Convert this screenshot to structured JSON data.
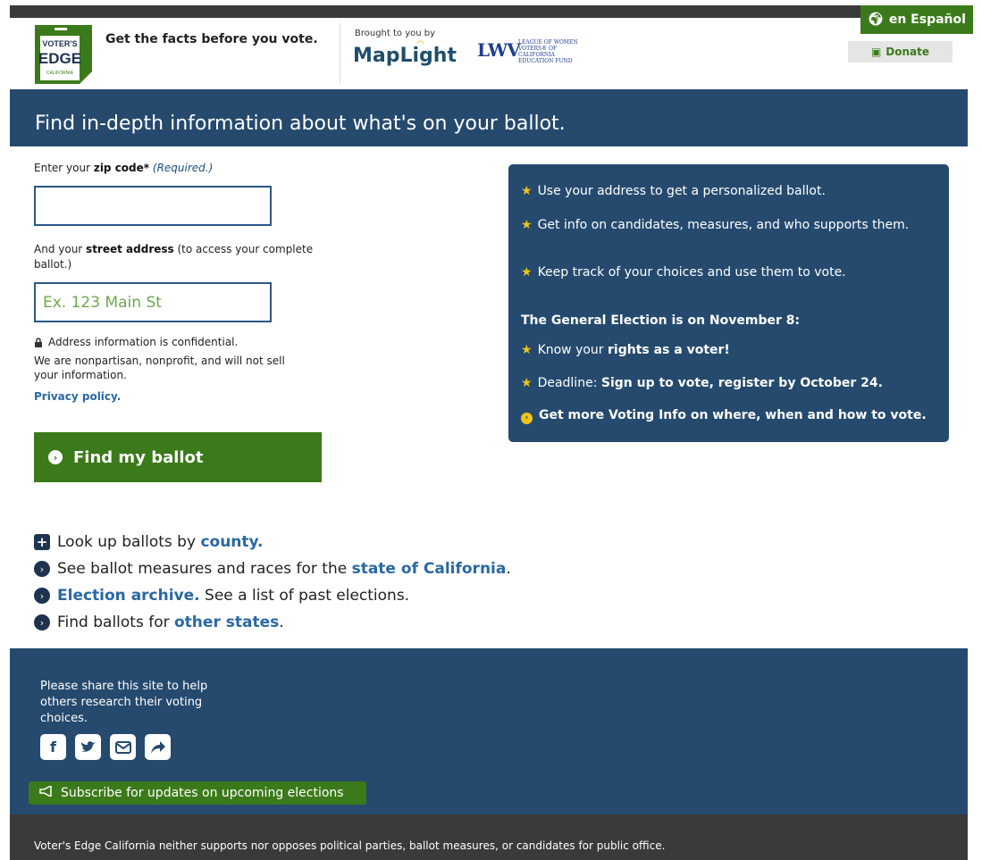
{
  "header": {
    "logo_line1": "VOTER'S",
    "logo_line2": "EDGE",
    "logo_line3": "CALIFORNIA",
    "tagline": "Get the facts before you vote.",
    "brought_by": "Brought to you by",
    "partner1": "MapLight",
    "partner2_mark": "LWV",
    "partner2_text": "LEAGUE OF WOMEN VOTERS® OF CALIFORNIA EDUCATION FUND",
    "espanol_label": "en Español",
    "donate_label": "Donate"
  },
  "banner": {
    "title": "Find in-depth information about what's on your ballot."
  },
  "form": {
    "zip_prefix": "Enter your ",
    "zip_bold": "zip code*",
    "zip_required": "(Required.)",
    "zip_value": "",
    "street_prefix": "And your ",
    "street_bold": "street address",
    "street_suffix": " (to access your complete ballot.)",
    "street_placeholder": "Ex. 123 Main St",
    "confidential": "Address information is confidential.",
    "nonpartisan": "We are nonpartisan, nonprofit, and will not sell your information.",
    "privacy": "Privacy policy.",
    "submit": "Find my ballot"
  },
  "infobox": {
    "item1": "Use your address to get a personalized ballot.",
    "item2": "Get info on candidates, measures, and who supports them.",
    "item3": "Keep track of your choices and use them to vote.",
    "election_heading": "The General Election is on November 8:",
    "rights_prefix": "Know your ",
    "rights_bold": "rights as a voter!",
    "deadline_prefix": "Deadline: ",
    "deadline_bold": "Sign up to vote, register by October 24.",
    "more_info": "Get more Voting Info on where, when and how to vote."
  },
  "links": {
    "county_prefix": "Look up ballots by ",
    "county_link": "county.",
    "state_prefix": "See ballot measures and races for the ",
    "state_link": "state of California",
    "state_suffix": ".",
    "archive_link": "Election archive.",
    "archive_suffix": " See a list of past elections.",
    "other_prefix": "Find ballots for ",
    "other_link": "other states",
    "other_suffix": "."
  },
  "footer": {
    "share_text": "Please share this site to help others research their voting choices.",
    "social_icons": [
      "facebook-icon",
      "twitter-icon",
      "email-icon",
      "share-icon"
    ],
    "subscribe": "Subscribe for updates on upcoming elections",
    "disclaimer": "Voter's Edge California neither supports nor opposes political parties, ballot measures, or candidates for public office."
  }
}
